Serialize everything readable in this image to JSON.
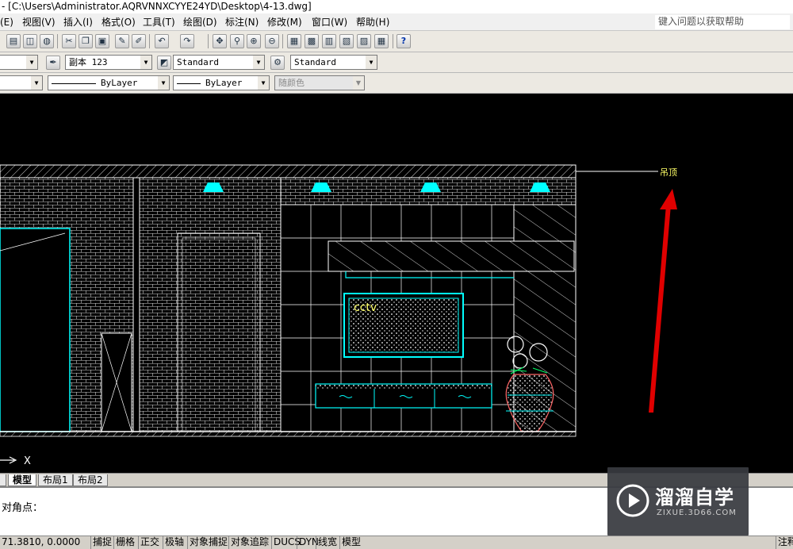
{
  "window": {
    "title": "- [C:\\Users\\Administrator.AQRVNNXCYYE24YD\\Desktop\\4-13.dwg]"
  },
  "menu": {
    "items": [
      "(E)",
      "视图(V)",
      "插入(I)",
      "格式(O)",
      "工具(T)",
      "绘图(D)",
      "标注(N)",
      "修改(M)",
      "窗口(W)",
      "帮助(H)"
    ],
    "help_placeholder": "键入问题以获取帮助"
  },
  "toolbar": {
    "text_style_label": "副本 123",
    "dim_style_label": "Standard",
    "table_style_label": "Standard",
    "linetype_label": "ByLayer",
    "lineweight_label": "ByLayer",
    "plotstyle_label": "随颜色"
  },
  "drawing": {
    "ceiling_label": "吊顶",
    "tv_label": "cctv",
    "axis_x_label": "X",
    "colors": {
      "background": "#000000",
      "lines": "#ffffff",
      "accent": "#00ffff",
      "leader_arrow": "#e00000",
      "label": "#ffff66"
    }
  },
  "tabs": {
    "model": "模型",
    "layout1": "布局1",
    "layout2": "布局2"
  },
  "command": {
    "prompt": "对角点："
  },
  "status": {
    "coords": "71.3810,  0.0000",
    "buttons": [
      "捕捉",
      "栅格",
      "正交",
      "极轴",
      "对象捕捉",
      "对象追踪",
      "DUCS",
      "DYN",
      "线宽",
      "模型"
    ],
    "right_label": "注释"
  },
  "watermark": {
    "title": "溜溜自学",
    "subtitle": "ZIXUE.3D66.COM"
  }
}
